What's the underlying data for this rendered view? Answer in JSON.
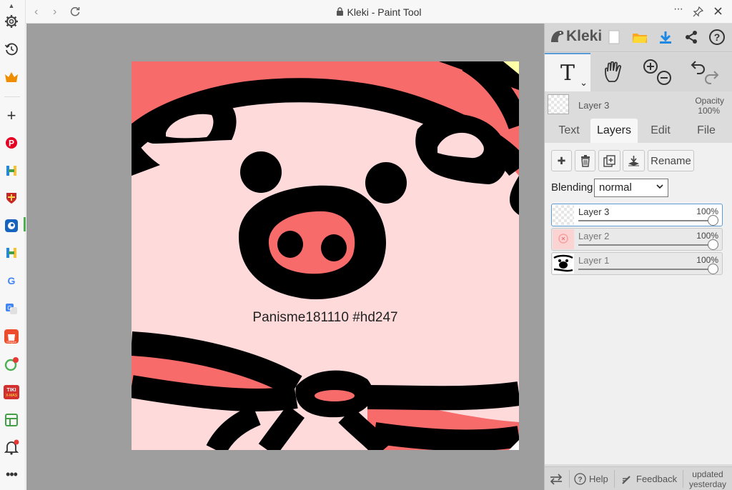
{
  "browser": {
    "title": "Kleki - Paint Tool",
    "back": "‹",
    "forward": "›",
    "more": "···"
  },
  "rail": {
    "icons": [
      "scroll-up-icon",
      "settings-icon",
      "history-icon",
      "crown-icon",
      "add-icon",
      "pinterest-icon",
      "app-h-icon",
      "shield-icon",
      "app-blue-icon",
      "app-h2-icon",
      "google-icon",
      "translate-icon",
      "shopee-icon",
      "chat-icon",
      "tiki-icon",
      "sheet-icon",
      "bell-icon",
      "more-icon"
    ],
    "shopee_text": "Shopee",
    "tiki_text": "TIKI X-MAS"
  },
  "canvas": {
    "watermark": "Panisme181110 #hd247",
    "colors": {
      "background": "#fedadb",
      "accent": "#f86b6b",
      "line": "#000000"
    }
  },
  "toolbar": {
    "brand": "Kleki"
  },
  "tools": {
    "text_tool": "T",
    "text_caret": "⌄"
  },
  "current_layer": {
    "name": "Layer 3",
    "opacity_label": "Opacity",
    "opacity_value": "100%"
  },
  "tabs": [
    "Text",
    "Layers",
    "Edit",
    "File"
  ],
  "layers_panel": {
    "add": "✚",
    "rename": "Rename",
    "blending_label": "Blending",
    "blending_value": "normal",
    "layers": [
      {
        "name": "Layer 3",
        "opacity": "100%",
        "opacity_value": 1.0
      },
      {
        "name": "Layer 2",
        "opacity": "100%",
        "opacity_value": 1.0
      },
      {
        "name": "Layer 1",
        "opacity": "100%",
        "opacity_value": 1.0
      }
    ]
  },
  "footer": {
    "help": "Help",
    "feedback": "Feedback",
    "updated": "updated",
    "updated_when": "yesterday"
  }
}
